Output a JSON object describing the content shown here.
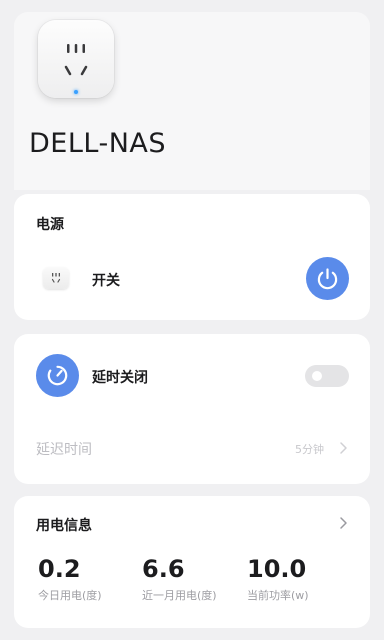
{
  "device": {
    "name": "DELL-NAS",
    "led_color": "#3aa0ff"
  },
  "power": {
    "title": "电源",
    "switch_label": "开关",
    "accent_color": "#5a8bea",
    "is_on": true
  },
  "timer": {
    "label": "延时关闭",
    "enabled": false,
    "delay_label": "延迟时间",
    "delay_value": "5分钟"
  },
  "usage": {
    "title": "用电信息",
    "stats": [
      {
        "value": "0.2",
        "label": "今日用电(度)"
      },
      {
        "value": "6.6",
        "label": "近一月用电(度)"
      },
      {
        "value": "10.0",
        "label": "当前功率(w)"
      }
    ]
  }
}
